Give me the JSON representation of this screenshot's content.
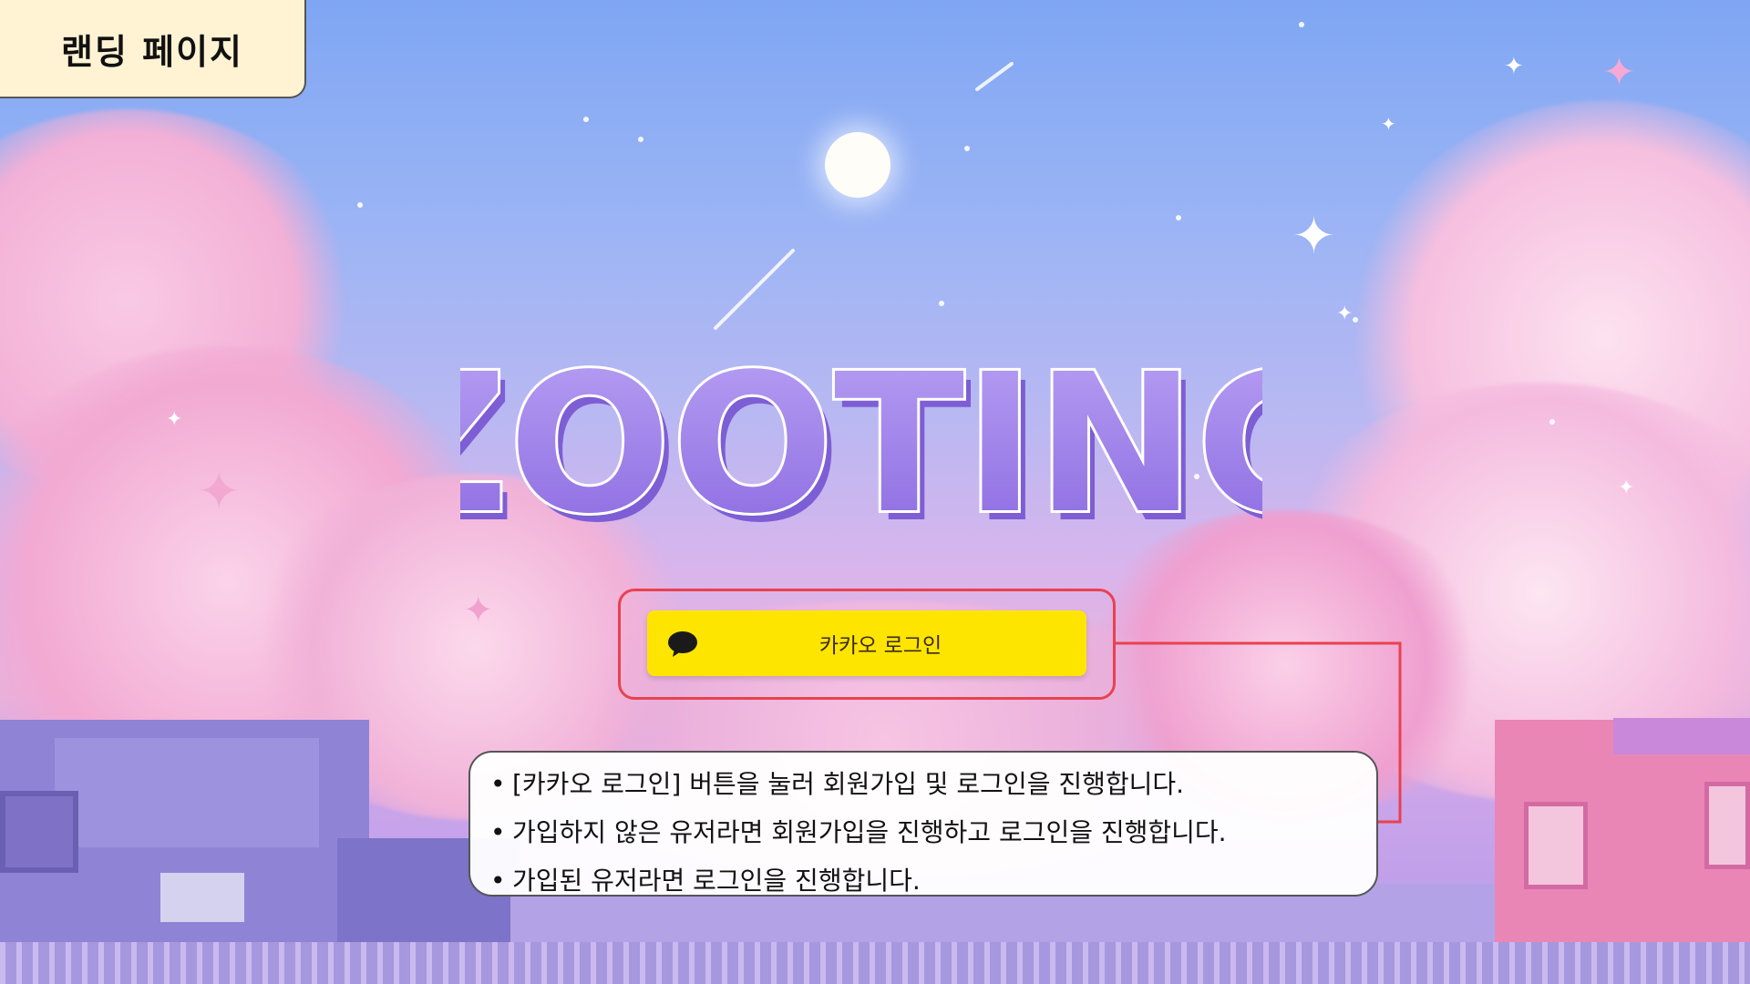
{
  "page_label": "랜딩 페이지",
  "logo": {
    "text": "ZOOTING"
  },
  "login": {
    "kakao_button_label": "카카오 로그인",
    "kakao_icon": "speech-bubble-icon"
  },
  "notes": [
    "[카카오 로그인] 버튼을 눌러 회원가입 및 로그인을 진행합니다.",
    "가입하지 않은 유저라면 회원가입을 진행하고 로그인을 진행합니다.",
    "가입된 유저라면 로그인을 진행합니다."
  ],
  "colors": {
    "kakao_yellow": "#fee500",
    "highlight_red": "#e8424f",
    "label_bg": "#fff3d4",
    "logo_purple": "#8f6fe3"
  }
}
